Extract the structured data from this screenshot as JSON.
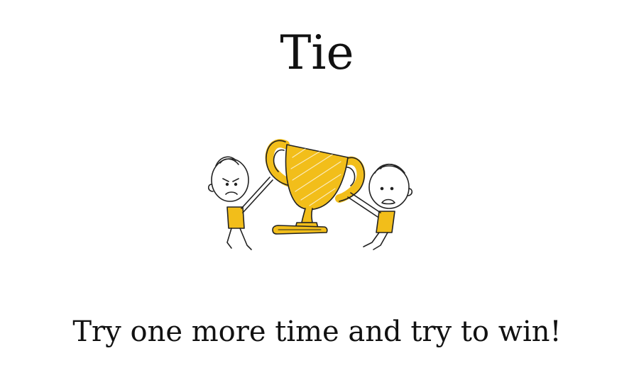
{
  "result": {
    "title": "Tie",
    "message": "Try one more time and try to win!"
  },
  "illustration": {
    "icon": "trophy-sharing-stick-figures-icon",
    "accent_color": "#F2BE1A",
    "ink_color": "#222222"
  }
}
